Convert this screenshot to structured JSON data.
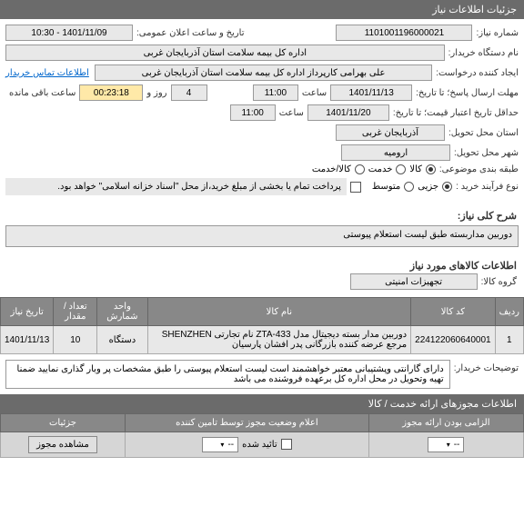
{
  "panel_title": "جزئیات اطلاعات نیاز",
  "fields": {
    "need_no_label": "شماره نیاز:",
    "need_no": "1101001196000021",
    "announce_label": "تاریخ و ساعت اعلان عمومی:",
    "announce_val": "1401/11/09 - 10:30",
    "buyer_org_label": "نام دستگاه خریدار:",
    "buyer_org": "اداره کل بیمه سلامت استان آذربایجان غربی",
    "creator_label": "ایجاد کننده درخواست:",
    "creator": "علی بهرامی کارپرداز اداره کل بیمه سلامت استان آذربایجان غربی",
    "contact_link": "اطلاعات تماس خریدار",
    "deadline_label": "مهلت ارسال پاسخ؛ تا تاریخ:",
    "deadline_date": "1401/11/13",
    "time_label": "ساعت",
    "deadline_time": "11:00",
    "days_left": "4",
    "days_unit": "روز و",
    "time_left": "00:23:18",
    "time_left_suffix": "ساعت باقی مانده",
    "min_valid_label": "حداقل تاریخ اعتبار قیمت؛ تا تاریخ:",
    "min_valid_date": "1401/11/20",
    "min_valid_time": "11:00",
    "province_label": "استان محل تحویل:",
    "province": "آذربایجان غربی",
    "city_label": "شهر محل تحویل:",
    "city": "ارومیه",
    "class_label": "طبقه بندی موضوعی:",
    "opt_kala": "کالا",
    "opt_khadamat": "خدمت",
    "opt_both": "کالا/خدمت",
    "process_label": "نوع فرآیند خرید :",
    "opt_low": "جزیی",
    "opt_mid": "متوسط",
    "process_note": "پرداخت تمام یا بخشی از مبلغ خرید،از محل \"اسناد خزانه اسلامی\" خواهد بود.",
    "desc_label": "شرح کلی نیاز:",
    "desc_val": "دوربین مداربسته طبق لیست استعلام پیوستی",
    "items_title": "اطلاعات کالاهای مورد نیاز",
    "group_label": "گروه کالا:",
    "group_val": "تجهیزات امنیتی"
  },
  "table": {
    "headers": [
      "ردیف",
      "کد کالا",
      "نام کالا",
      "واحد شمارش",
      "تعداد / مقدار",
      "تاریخ نیاز"
    ],
    "rows": [
      {
        "idx": "1",
        "code": "224122060640001",
        "name": "دوربین مدار بسته دیجیتال مدل ZTA-433 نام تجارتی SHENZHEN مرجع عرضه کننده بازرگانی پدر افشان پارسیان",
        "unit": "دستگاه",
        "qty": "10",
        "date": "1401/11/13"
      }
    ]
  },
  "buyer_notes": {
    "label": "توضیحات خریدار:",
    "text": "دارای گارانتی وپشتیبانی معتبر خواهشمند است لیست استعلام پیوستی را طبق مشخصات پر وبار گذاری نمایید ضمنا تهیه وتحویل در محل اداره کل برعهده فروشنده می باشد"
  },
  "auth_section": {
    "title": "اطلاعات مجوزهای ارائه خدمت / کالا",
    "headers": [
      "الزامی بودن ارائه مجوز",
      "اعلام وضعیت مجوز توسط تامین کننده",
      "جزئیات"
    ],
    "cell_taeed_label": "تائید شده",
    "btn_view": "مشاهده مجوز",
    "select_placeholder": "--"
  }
}
